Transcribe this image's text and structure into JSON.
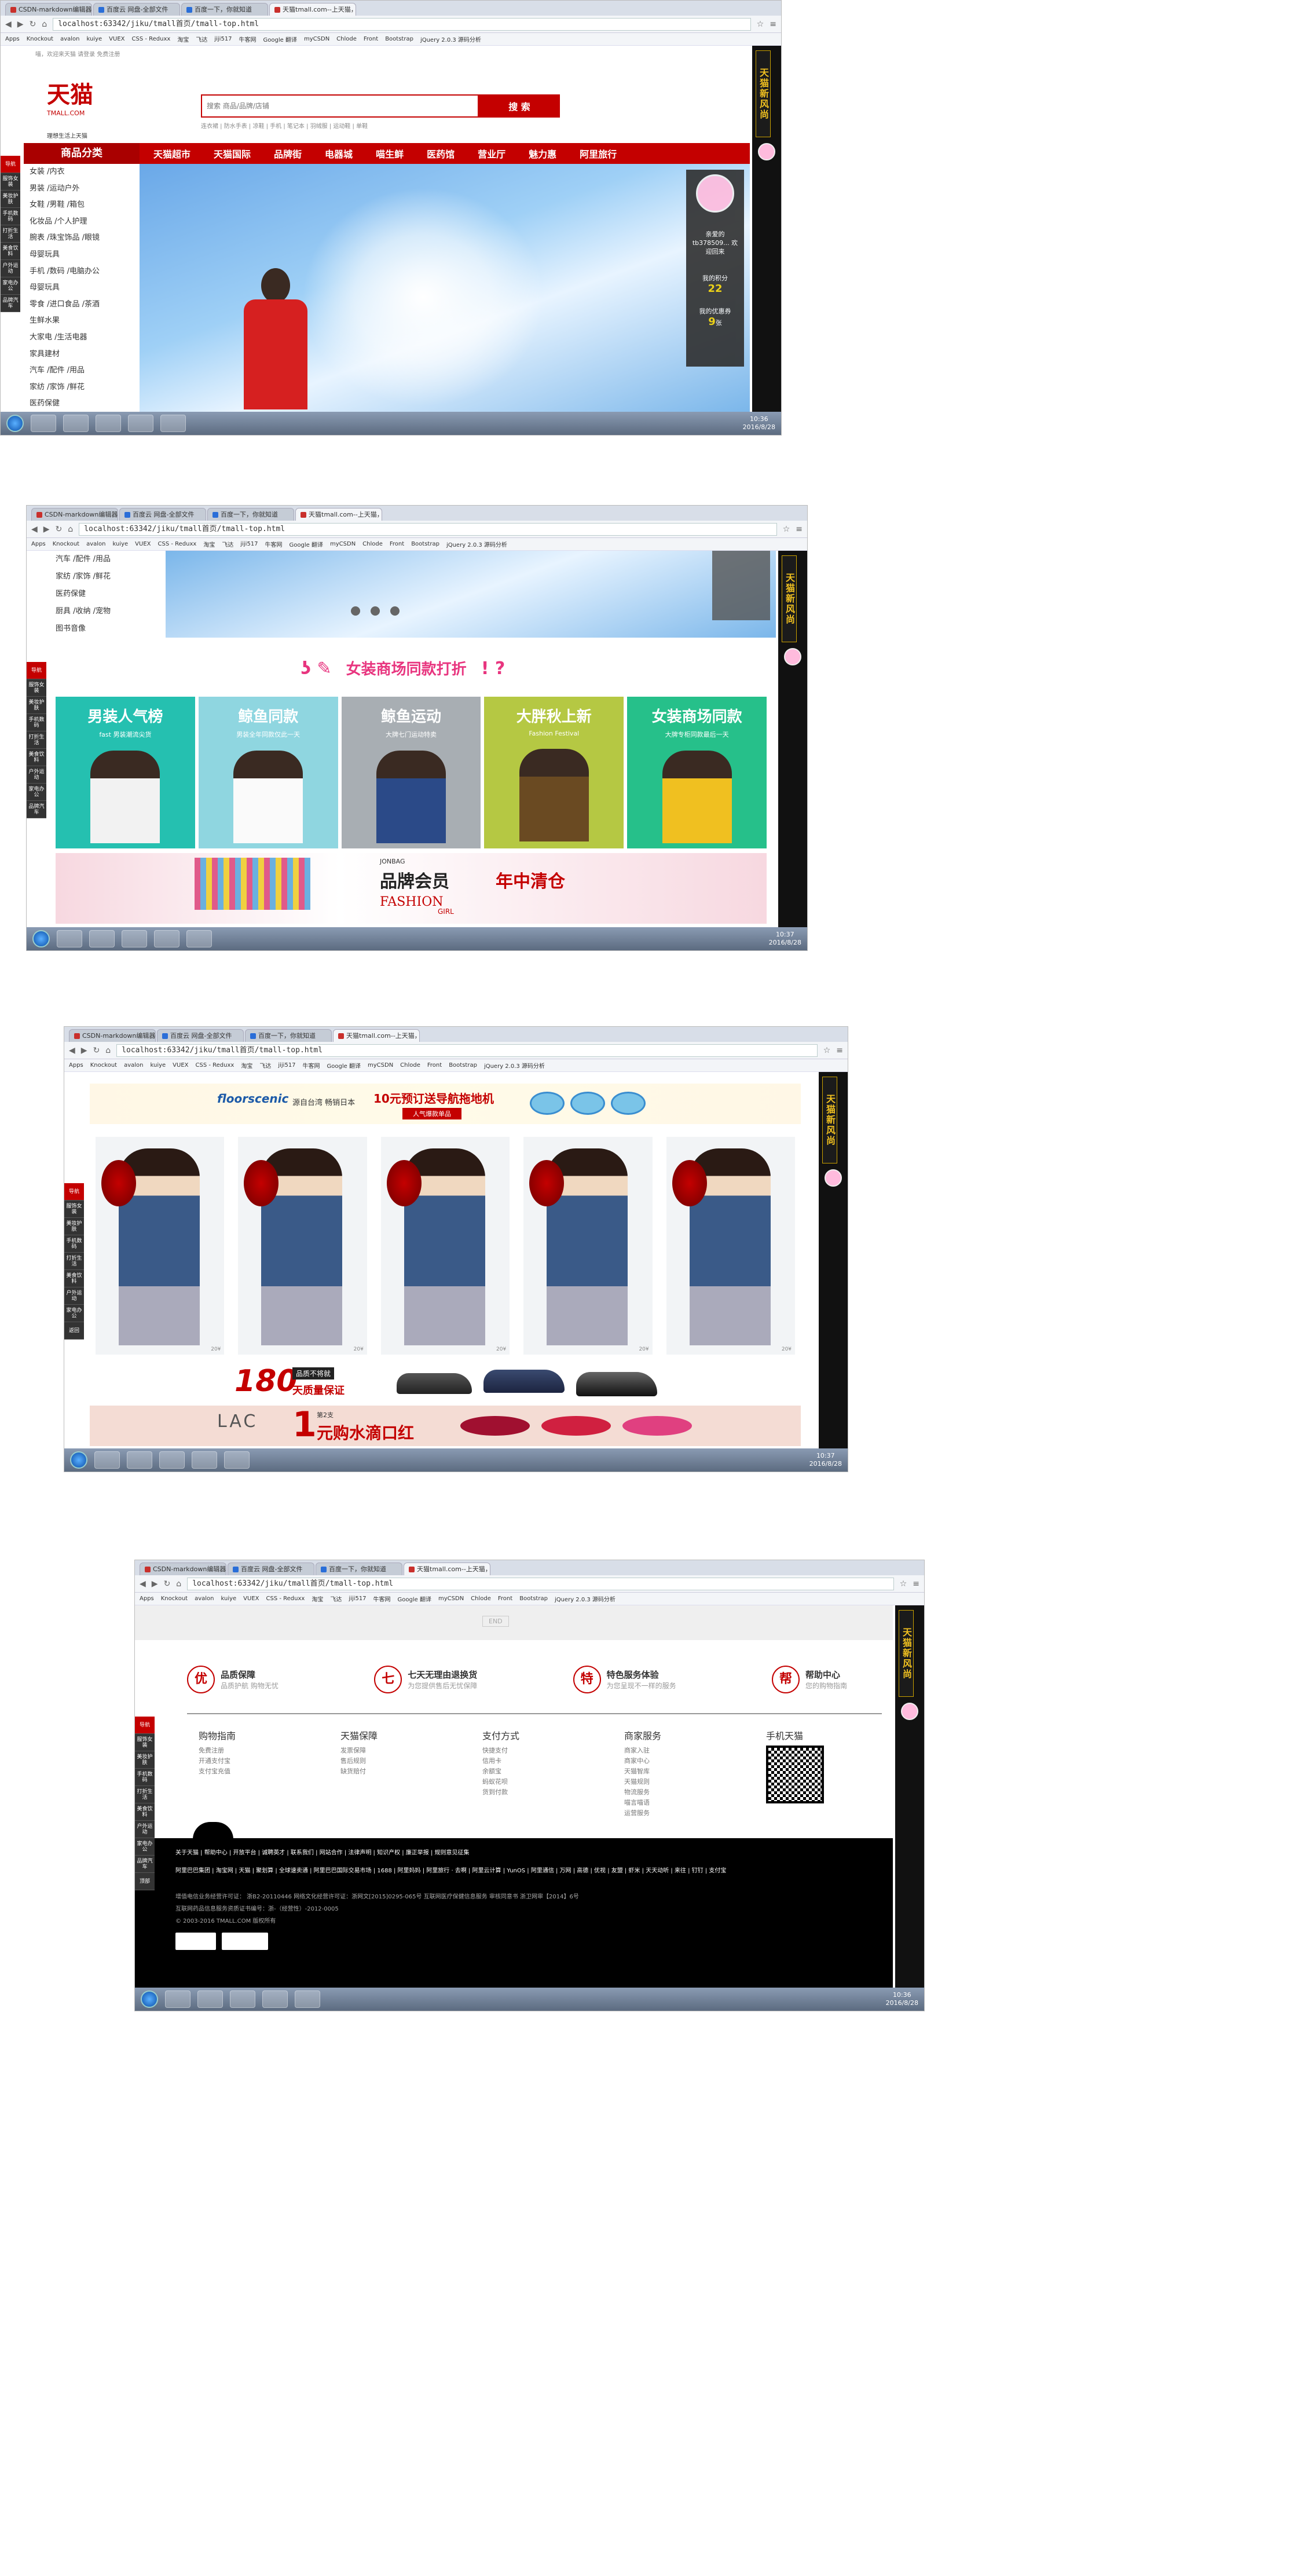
{
  "browser": {
    "tabs": [
      "CSDN-markdown编辑器",
      "百度云 网盘-全部文件",
      "百度一下，你就知道",
      "天猫tmall.com--上天猫，"
    ],
    "url": "localhost:63342/jiku/tmall首页/tmall-top.html",
    "bookmarks": [
      "Apps",
      "Knockout",
      "avalon",
      "kuiye",
      "VUEX",
      "CSS - Reduxx",
      "淘宝",
      "飞达",
      "jiji517",
      "牛客网",
      "Google 翻译",
      "myCSDN",
      "Chlode",
      "Front",
      "Bootstrap",
      "jQuery 2.0.3 源码分析"
    ],
    "clocks": [
      {
        "time": "10:36",
        "date": "2016/8/28"
      },
      {
        "time": "10:37",
        "date": "2016/8/28"
      },
      {
        "time": "10:37",
        "date": "2016/8/28"
      },
      {
        "time": "10:36",
        "date": "2016/8/28"
      }
    ]
  },
  "rightbar": {
    "promo": "天猫新风尚"
  },
  "leftnav": [
    "导航",
    "服饰女装",
    "美妆护肤",
    "手机数码",
    "打折生活",
    "美食饮料",
    "户外运动",
    "家电办公",
    "品牌汽车",
    "返回",
    "顶部"
  ],
  "header": {
    "logo": "天猫",
    "logo_sub": "TMALL.COM",
    "slogan": "理想生活上天猫",
    "search_placeholder": "搜索 商品/品牌/店铺",
    "search_button": "搜 索",
    "hot_words": "连衣裙 | 防水手表 | 凉鞋 | 手机 | 笔记本 | 羽绒服 | 运动鞋 | 单鞋",
    "top_links": "喵，欢迎来天猫  请登录  免费注册"
  },
  "nav": {
    "category_title": "商品分类",
    "links": [
      "天猫超市",
      "天猫国际",
      "品牌街",
      "电器城",
      "喵生鲜",
      "医药馆",
      "营业厅",
      "魅力惠",
      "阿里旅行"
    ]
  },
  "categories": [
    "女装 /内衣",
    "男装 /运动户外",
    "女鞋 /男鞋 /箱包",
    "化妆品 /个人护理",
    "腕表 /珠宝饰品 /眼镜",
    "母婴玩具",
    "手机 /数码 /电脑办公",
    "母婴玩具",
    "零食 /进口食品 /茶酒",
    "生鲜水果",
    "大家电 /生活电器",
    "家具建材",
    "汽车 /配件 /用品",
    "家纺 /家饰 /鲜花",
    "医药保健"
  ],
  "user_panel": {
    "greeting": "亲爱的 tb378509... 欢迎回来",
    "points_label": "我的积分",
    "points": "22",
    "coupons_label": "我的优惠券",
    "coupons": "9",
    "coupons_unit": "张"
  },
  "shot2": {
    "categories": [
      "汽车 /配件 /用品",
      "家纺 /家饰 /鲜花",
      "医药保健",
      "厨具 /收纳 /宠物",
      "图书音像"
    ],
    "floor_title": "女装商场同款打折",
    "promos": [
      {
        "title": "男装人气榜",
        "sub": "fast 男装潮流尖货",
        "color": "#25c0b0"
      },
      {
        "title": "鲸鱼同款",
        "sub": "男装全年同款仅此一天",
        "color": "#8fd6e0"
      },
      {
        "title": "鲸鱼运动",
        "sub": "大牌七门运动特卖",
        "color": "#a8aeb3"
      },
      {
        "title": "大胖秋上新",
        "sub": "Fashion Festival",
        "color": "#b5c843"
      },
      {
        "title": "女装商场同款",
        "sub": "大牌专柜同款最后一天",
        "color": "#26c08a"
      }
    ],
    "banner_title": "品牌会员",
    "banner_hot": "年中清仓",
    "banner_tag": "FASHION",
    "banner_tag2": "GIRL",
    "banner_brand": "JONBAG"
  },
  "shot3": {
    "brand": "floorscenic",
    "brand_sub": "源自台湾 畅销日本",
    "offer": "10元预订送导航拖地机",
    "offer_btn": "人气爆款单品",
    "product_tag": "20¥",
    "shoe_num": "180",
    "shoe_text": "天质量保证",
    "shoe_tag": "品质不将就",
    "lip_brand": "LAC",
    "lip_num": "1",
    "lip_text": "元购水滴口红",
    "lip_tag": "第2支"
  },
  "shot4": {
    "end": "END",
    "guarantees": [
      {
        "icon": "优",
        "title": "品质保障",
        "sub": "品质护航 购物无忧"
      },
      {
        "icon": "七",
        "title": "七天无理由退换货",
        "sub": "为您提供售后无忧保障"
      },
      {
        "icon": "特",
        "title": "特色服务体验",
        "sub": "为您呈现不一样的服务"
      },
      {
        "icon": "帮",
        "title": "帮助中心",
        "sub": "您的购物指南"
      }
    ],
    "cols": [
      {
        "title": "购物指南",
        "items": [
          "免费注册",
          "开通支付宝",
          "支付宝充值"
        ]
      },
      {
        "title": "天猫保障",
        "items": [
          "发票保障",
          "售后规则",
          "缺货赔付"
        ]
      },
      {
        "title": "支付方式",
        "items": [
          "快捷支付",
          "信用卡",
          "余额宝",
          "蚂蚁花呗",
          "货到付款"
        ]
      },
      {
        "title": "商家服务",
        "items": [
          "商家入驻",
          "商家中心",
          "天猫智库",
          "天猫规则",
          "物流服务",
          "喵言喵语",
          "运营服务"
        ]
      }
    ],
    "qr_title": "手机天猫",
    "links1": "关于天猫 | 帮助中心 | 开放平台 | 诚聘英才 | 联系我们 | 网站合作 | 法律声明 | 知识产权 | 廉正举报 | 规则意见征集",
    "links2": "阿里巴巴集团 | 淘宝网 | 天猫 | 聚划算 | 全球速卖通 | 阿里巴巴国际交易市场 | 1688 | 阿里妈妈 | 阿里旅行 · 去啊 | 阿里云计算 | YunOS | 阿里通信 | 万网 | 高德 | 优视 | 友盟 | 虾米 | 天天动听 | 来往 | 钉钉 | 支付宝",
    "license1": "增值电信业务经营许可证： 浙B2-20110446    网络文化经营许可证：浙网文[2015]0295-065号    互联网医疗保健信息服务 审核同意书 浙卫网审【2014】6号",
    "license2": "互联网药品信息服务资质证书编号：浙-（经营性）-2012-0005",
    "copyright": "© 2003-2016 TMALL.COM 版权所有"
  }
}
